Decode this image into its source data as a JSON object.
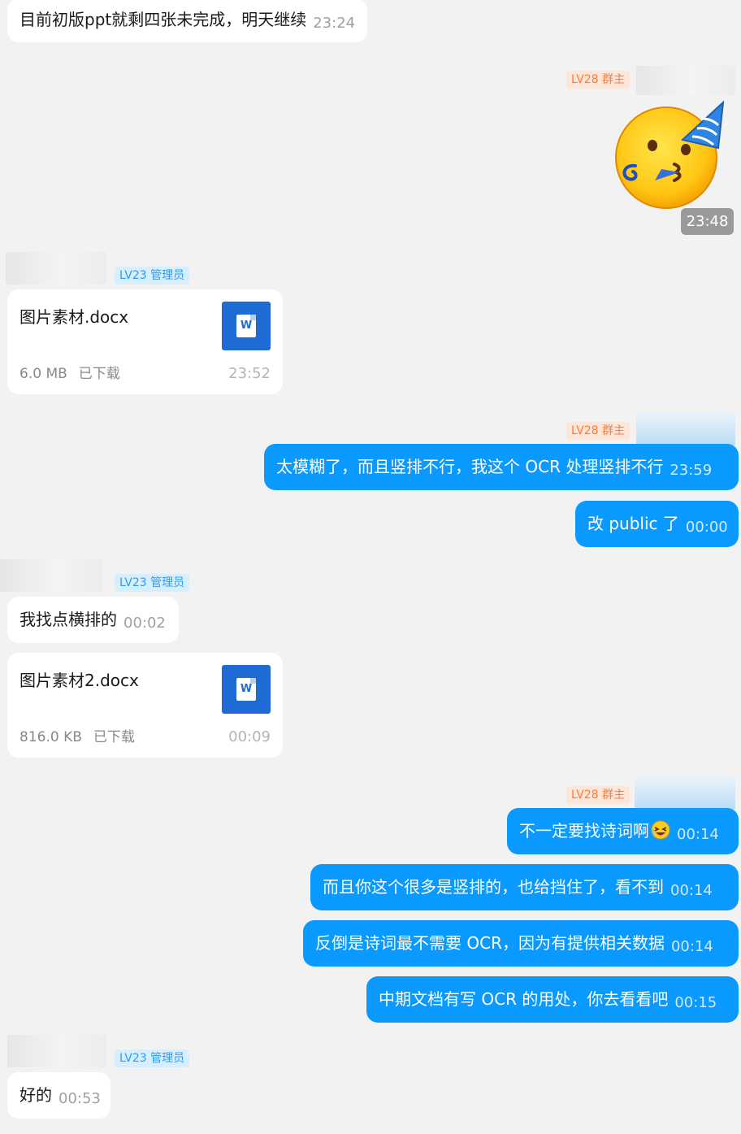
{
  "messages": {
    "m1": {
      "text": "目前初版ppt就剩四张未完成，明天继续",
      "time": "23:24"
    },
    "sticker": {
      "time": "23:48",
      "icon": "party-face-icon"
    },
    "file1": {
      "name": "图片素材.docx",
      "size": "6.0 MB",
      "status": "已下载",
      "time": "23:52",
      "icon": "word-doc-icon"
    },
    "m2": {
      "text": "太模糊了，而且竖排不行，我这个 OCR 处理竖排不行",
      "time": "23:59"
    },
    "m3": {
      "text": "改 public 了",
      "time": "00:00"
    },
    "m4": {
      "text": "我找点横排的",
      "time": "00:02"
    },
    "file2": {
      "name": "图片素材2.docx",
      "size": "816.0 KB",
      "status": "已下载",
      "time": "00:09",
      "icon": "word-doc-icon"
    },
    "m5": {
      "text": "不一定要找诗词啊",
      "time": "00:14",
      "emoji": "laughing-emoji"
    },
    "m6": {
      "text": "而且你这个很多是竖排的，也给挡住了，看不到",
      "time": "00:14"
    },
    "m7": {
      "text": "反倒是诗词最不需要 OCR，因为有提供相关数据",
      "time": "00:14"
    },
    "m8": {
      "text": "中期文档有写 OCR 的用处，你去看看吧",
      "time": "00:15"
    },
    "m9": {
      "text": "好的",
      "time": "00:53"
    }
  },
  "badges": {
    "owner": "LV28 群主",
    "admin": "LV23 管理员"
  },
  "file_icon_letter": "W",
  "colors": {
    "outgoing_bubble": "#0a99ff",
    "incoming_bubble": "#ffffff",
    "background": "#f2f2f2",
    "admin_badge": "#2d9cf0",
    "owner_badge": "#f57f3f"
  }
}
